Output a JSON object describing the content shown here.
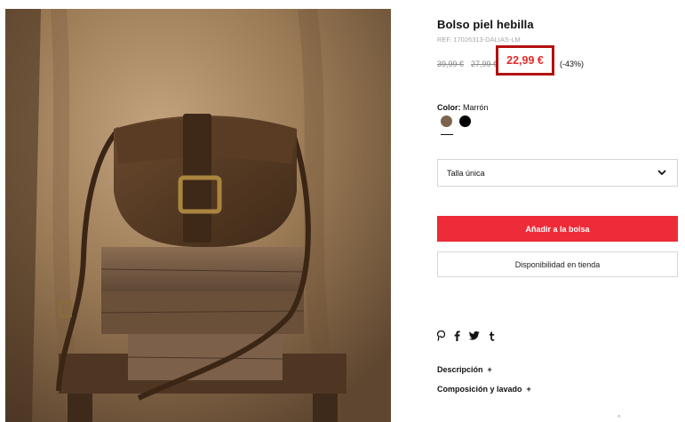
{
  "product": {
    "title": "Bolso piel hebilla",
    "ref": "REF. 17026313-DALIAS-LM",
    "price_original": "39,99 €",
    "price_previous": "27,99 €",
    "price_current": "22,99 €",
    "discount": "(-43%)"
  },
  "color": {
    "label": "Color:",
    "value": "Marrón",
    "options": [
      {
        "name": "brown",
        "hex": "#7d634d",
        "selected": true
      },
      {
        "name": "black",
        "hex": "#000000",
        "selected": false
      }
    ]
  },
  "size": {
    "selected": "Talla única"
  },
  "actions": {
    "add_to_bag": "Añadir a la bolsa",
    "store_availability": "Disponibilidad en tienda"
  },
  "share": {
    "icons": [
      "pinterest-icon",
      "facebook-icon",
      "twitter-icon",
      "tumblr-icon"
    ]
  },
  "accordions": [
    {
      "label": "Descripción",
      "symbol": "+"
    },
    {
      "label": "Composición y lavado",
      "symbol": "+"
    }
  ],
  "colors": {
    "accent": "#ee2b38",
    "highlight_border": "#b3100f",
    "price_red": "#e32b2b"
  }
}
